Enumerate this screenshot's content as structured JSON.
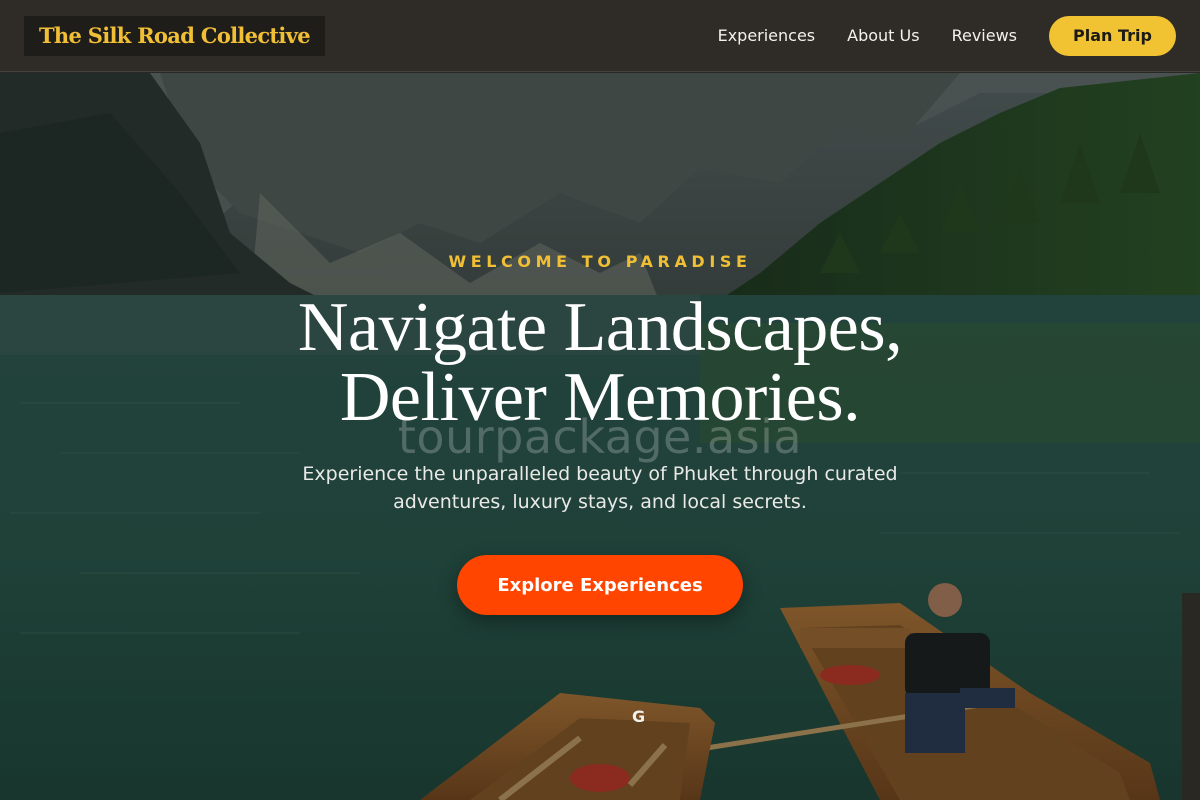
{
  "brand": {
    "name": "The Silk Road Collective"
  },
  "nav": {
    "links": [
      "Experiences",
      "About Us",
      "Reviews"
    ],
    "cta_label": "Plan Trip"
  },
  "hero": {
    "eyebrow": "WELCOME TO PARADISE",
    "headline_line1": "Navigate Landscapes,",
    "headline_line2": "Deliver Memories.",
    "watermark": "tourpackage.asia",
    "subtitle": "Experience the unparalleled beauty of Phuket through curated adventures, luxury stays, and local secrets.",
    "cta_label": "Explore Experiences",
    "boat_letter": "G"
  },
  "colors": {
    "accent_gold": "#f1c232",
    "cta_orange": "#ff4500",
    "nav_bg": "#2f2c27"
  }
}
